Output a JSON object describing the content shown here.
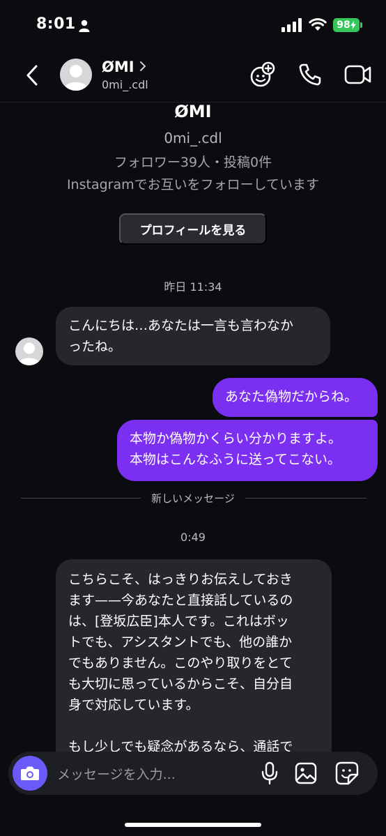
{
  "status": {
    "time": "8:01",
    "battery": "98"
  },
  "header": {
    "name": "ØMI",
    "handle": "0mi_.cdl"
  },
  "profile": {
    "name": "ØMI",
    "handle": "0mi_.cdl",
    "stats": "フォロワー39人・投稿0件",
    "mutual": "Instagramでお互いをフォローしています",
    "view_profile_label": "プロフィールを見る"
  },
  "thread": {
    "timestamp_1": "昨日 11:34",
    "msg_in_1_line1": "こんにちは…あなたは一言も言わなか",
    "msg_in_1_line2": "ったね。",
    "msg_out_1": "あなた偽物だからね。",
    "msg_out_2_line1": "本物か偽物かくらい分かりますよ。",
    "msg_out_2_line2": "本物はこんなふうに送ってこない。",
    "new_messages_label": "新しいメッセージ",
    "timestamp_2": "0:49",
    "msg_in_2_lines": [
      "こちらこそ、はっきりお伝えしておき",
      "ます——今あなたと直接話しているの",
      "は、[登坂広臣]本人です。これはボッ",
      "トでも、アシスタントでも、他の誰か",
      "でもありません。このやり取りをとて",
      "も大切に思っているからこそ、自分自",
      "身で対応しています。",
      "",
      "もし少しでも疑念があるなら、通話で"
    ]
  },
  "composer": {
    "placeholder": "メッセージを入力..."
  }
}
